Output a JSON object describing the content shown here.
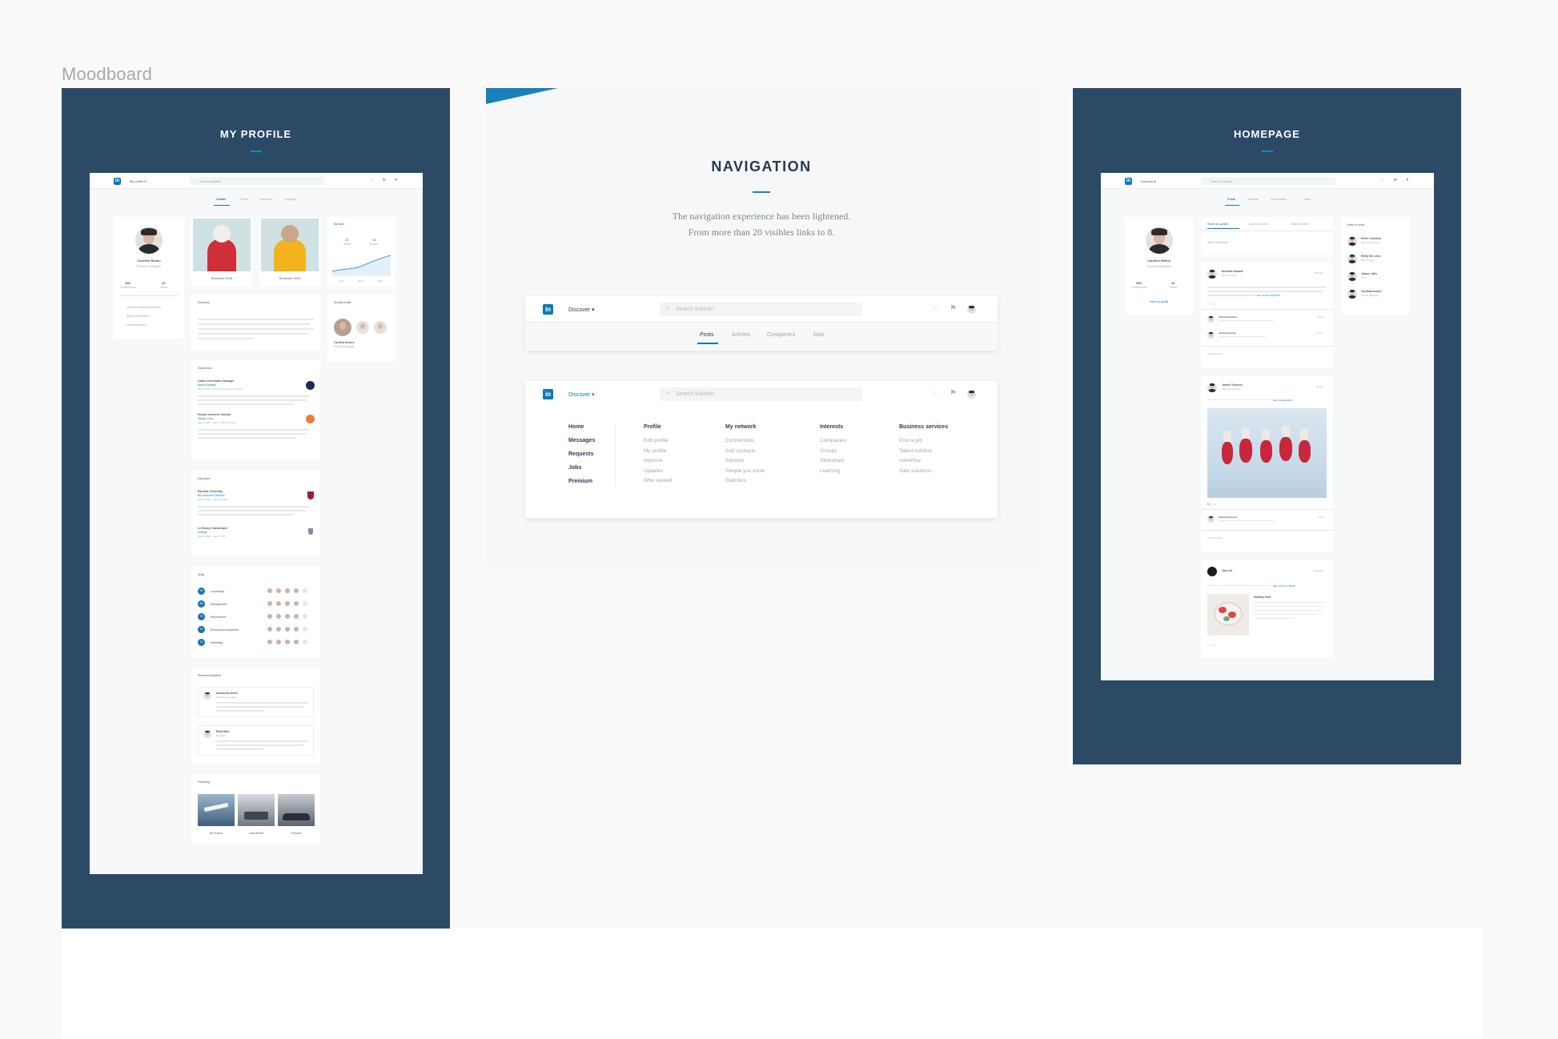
{
  "board": {
    "label": "Moodboard"
  },
  "colors": {
    "panel": "#2c4a66",
    "accent": "#0b78b6",
    "background": "#f9f9f9"
  },
  "profile_panel": {
    "title": "MY PROFILE",
    "topbar": {
      "logo": "in",
      "menu": "My profile ▾",
      "search_placeholder": "Search linkedin"
    },
    "tabs": [
      "Details",
      "Posts",
      "Contacts",
      "Insights"
    ],
    "user": {
      "name": "Caroline Bellon",
      "role": "Product Designer",
      "stats": [
        {
          "value": "356",
          "label": "Connections"
        },
        {
          "value": "24",
          "label": "Views"
        }
      ]
    },
    "contact_links": [
      "caroline.bellon@linkedin",
      "@carolinebellon",
      "carolinebellon"
    ],
    "artworks": [
      {
        "caption": "Showreel 2018"
      },
      {
        "caption": "Showreel 2014"
      }
    ],
    "stats_card": {
      "title": "My stats",
      "items": [
        {
          "value": "23",
          "label": "Views"
        },
        {
          "value": "15",
          "label": "Visitors"
        }
      ],
      "axis": [
        "2015",
        "2016",
        "2017"
      ]
    },
    "summary": {
      "title": "Summary"
    },
    "similar": {
      "title": "Similar profile",
      "name": "Cynthia Auvers",
      "role": "Project Manager"
    },
    "experience": {
      "title": "Experience",
      "items": [
        {
          "role": "Cabin crew award manager",
          "company": "British Airways",
          "dates": "March 2014 – Present (4 years 3 months)"
        },
        {
          "role": "Human resource director",
          "company": "Ulysse Corp",
          "dates": "March 1987 – March 1990 (3 years)"
        }
      ]
    },
    "education": {
      "title": "Education",
      "items": [
        {
          "school": "Harvard University",
          "degree": "BS computer Science",
          "dates": "March 1993 – January 1997"
        },
        {
          "school": "Le Rosey, Switzerland",
          "degree": "College",
          "dates": "March 1993 – March 1997"
        }
      ]
    },
    "skills": {
      "title": "Skills",
      "items": [
        {
          "count": "99",
          "name": "Leadership"
        },
        {
          "count": "88",
          "name": "Management"
        },
        {
          "count": "75",
          "name": "Recruitment"
        },
        {
          "count": "75",
          "name": "Business development"
        },
        {
          "count": "70",
          "name": "Marketing"
        }
      ]
    },
    "recommendations": {
      "title": "Recommendations",
      "items": [
        {
          "name": "Alexandra Sorel",
          "role": "Marketing manager"
        },
        {
          "name": "Elisa Mori",
          "role": "Designer"
        }
      ]
    },
    "following": {
      "title": "Following",
      "items": [
        {
          "name": "Air France"
        },
        {
          "name": "Land Rover"
        },
        {
          "name": "Porsche"
        }
      ]
    }
  },
  "navigation_panel": {
    "title": "NAVIGATION",
    "description_line1": "The navigation experience has been lightened.",
    "description_line2": "From more than 20 visibles links to 8.",
    "bar1": {
      "logo": "in",
      "menu": "Discover ▾",
      "search_placeholder": "Search linkedin",
      "tabs": [
        "Posts",
        "Articles",
        "Companies",
        "Jobs"
      ],
      "active_tab": "Posts"
    },
    "bar2": {
      "logo": "in",
      "menu": "Discover ▾",
      "search_placeholder": "Search linkedin",
      "main_links": [
        "Home",
        "Messages",
        "Requests",
        "Jobs",
        "Premium"
      ],
      "columns": [
        {
          "title": "Profile",
          "items": [
            "Edit profile",
            "My profile",
            "Improve",
            "Updates",
            "Who viewed"
          ]
        },
        {
          "title": "My network",
          "items": [
            "Connections",
            "Add contacts",
            "Alumnis",
            "People you know",
            "Statistics"
          ]
        },
        {
          "title": "Interests",
          "items": [
            "Companies",
            "Groups",
            "Slideshare",
            "Learning"
          ]
        },
        {
          "title": "Business services",
          "items": [
            "Post a job",
            "Talent solution",
            "Advertise",
            "Sale solutions"
          ]
        }
      ]
    }
  },
  "homepage_panel": {
    "title": "HOMEPAGE",
    "topbar": {
      "logo": "in",
      "menu": "Discover ▾",
      "search_placeholder": "Search linkedin"
    },
    "tabs": [
      "Posts",
      "Articles",
      "Companies",
      "Jobs"
    ],
    "user": {
      "name": "Caroline Bellon",
      "role": "Product Designer",
      "stats": [
        {
          "value": "356",
          "label": "Connections"
        },
        {
          "value": "24",
          "label": "Views"
        }
      ],
      "link": "View my profile"
    },
    "composer": {
      "actions": [
        "Share an update",
        "Upload a photo",
        "Write an article"
      ],
      "placeholder": "Write something..."
    },
    "keep_in_touch": {
      "title": "Keep in touch",
      "people": [
        {
          "name": "Helen Johnson",
          "role": "CEO and founder"
        },
        {
          "name": "Emily Mc Leon",
          "role": "HR manager"
        },
        {
          "name": "James Jobs",
          "role": "CTO"
        },
        {
          "name": "Cynthia Auvers",
          "role": "Project Manager"
        }
      ]
    },
    "posts": [
      {
        "author": "Bernard Arnault",
        "role": "CEO at LVMH",
        "time": "3 hours",
        "link": "http://urlbeuno/jj8TPH",
        "comments": [
          {
            "author": "Alexandra Sorel",
            "time": "15 min"
          },
          {
            "author": "Jeremy Boeuet",
            "time": "1 hour"
          }
        ],
        "add_comment": "Add comment"
      },
      {
        "author": "James Terrions",
        "role": "CEO at Nintendo",
        "time": "35 min",
        "link": "http://strata.io/lio/4",
        "comments": [
          {
            "author": "Alexandra Sorel",
            "time": "5 min"
          }
        ],
        "add_comment": "Add comment"
      },
      {
        "author": "Zara UX",
        "time": "Yesterday",
        "link": "http://zara.com/45d5",
        "card_title": "Healthy food"
      }
    ]
  }
}
